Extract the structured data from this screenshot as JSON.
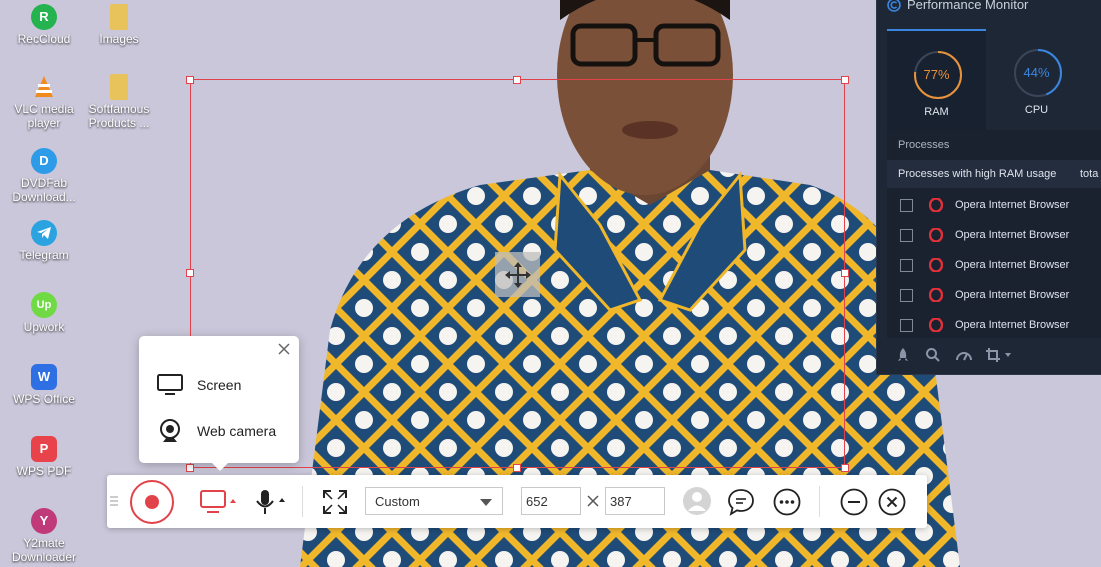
{
  "desktop": {
    "icons": [
      {
        "label": "RecCloud",
        "icon": "reccloud-icon",
        "color": "#24b34f"
      },
      {
        "label": "Images",
        "icon": "folder-icon",
        "color": "#e8c25a"
      },
      {
        "label": "VLC media player",
        "icon": "vlc-icon",
        "color": "#f28b1e"
      },
      {
        "label": "Softfamous Products ...",
        "icon": "folder-icon",
        "color": "#e8c25a"
      },
      {
        "label": "DVDFab Download...",
        "icon": "dvdfab-icon",
        "color": "#2d9be8"
      },
      {
        "label": "Telegram",
        "icon": "telegram-icon",
        "color": "#2aa3e0"
      },
      {
        "label": "Upwork",
        "icon": "upwork-icon",
        "color": "#6fda44"
      },
      {
        "label": "WPS Office",
        "icon": "wps-office-icon",
        "color": "#2f6fe4"
      },
      {
        "label": "WPS PDF",
        "icon": "wps-pdf-icon",
        "color": "#e8424a"
      },
      {
        "label": "Y2mate Downloader",
        "icon": "y2mate-icon",
        "color": "#c03a7a"
      }
    ]
  },
  "popup": {
    "items": [
      {
        "label": "Screen",
        "icon": "monitor-icon"
      },
      {
        "label": "Web camera",
        "icon": "webcam-icon"
      }
    ]
  },
  "toolbar": {
    "region_mode": "Custom",
    "width": "652",
    "height": "387",
    "accent_color": "#e2434b"
  },
  "perf": {
    "title": "Performance Monitor",
    "tabs": [
      {
        "label": "RAM",
        "value": "77%",
        "percent": 77,
        "color": "#e8923a"
      },
      {
        "label": "CPU",
        "value": "44%",
        "percent": 44,
        "color": "#3a86e0"
      }
    ],
    "section": "Processes",
    "subhead": "Processes with high RAM usage",
    "subhead_right": "tota",
    "processes": [
      {
        "name": "Opera Internet Browser"
      },
      {
        "name": "Opera Internet Browser"
      },
      {
        "name": "Opera Internet Browser"
      },
      {
        "name": "Opera Internet Browser"
      },
      {
        "name": "Opera Internet Browser"
      }
    ]
  }
}
